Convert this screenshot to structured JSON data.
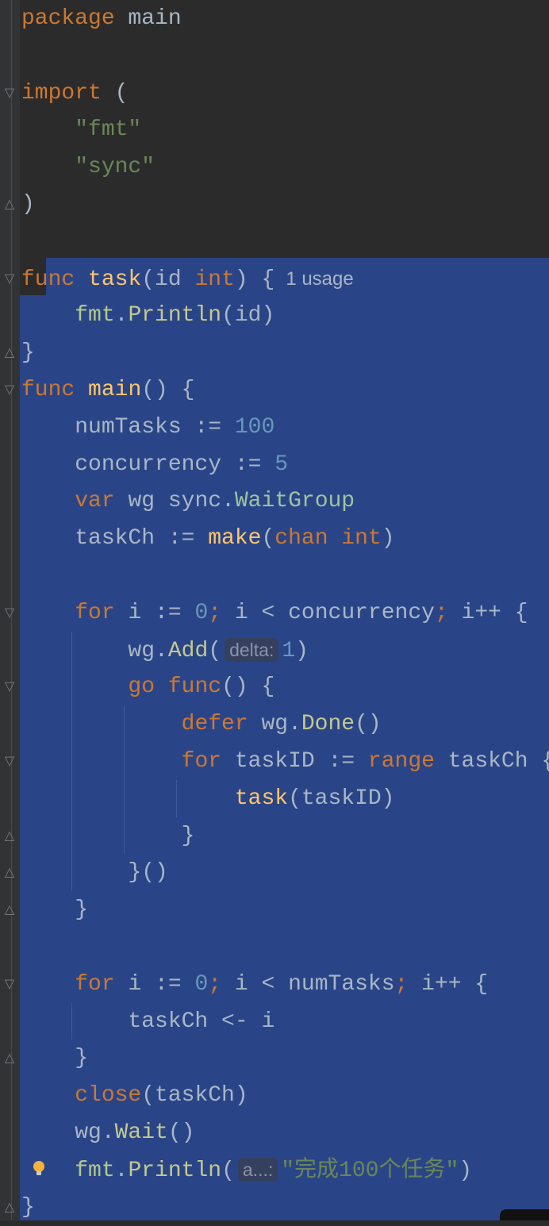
{
  "editor": {
    "colors": {
      "selection": "#2a4587",
      "background": "#2b2b2b",
      "keyword": "#cc7832",
      "function": "#ffc66d",
      "string": "#6a8759",
      "number": "#6897bb"
    },
    "lines": [
      [
        [
          "package",
          "kw"
        ],
        [
          " main",
          "plain"
        ]
      ],
      [],
      [
        [
          "import",
          "kw"
        ],
        [
          " (",
          "plain"
        ]
      ],
      [
        [
          "    ",
          "plain"
        ],
        [
          "\"fmt\"",
          "str"
        ]
      ],
      [
        [
          "    ",
          "plain"
        ],
        [
          "\"sync\"",
          "str"
        ]
      ],
      [
        [
          ")",
          "plain"
        ]
      ],
      [],
      [
        [
          "func",
          "kw"
        ],
        [
          " ",
          "plain"
        ],
        [
          "task",
          "fn"
        ],
        [
          "(id ",
          "plain"
        ],
        [
          "int",
          "kw"
        ],
        [
          ") {",
          "plain"
        ],
        [
          "1 usage",
          "usage"
        ]
      ],
      [
        [
          "    ",
          "plain"
        ],
        [
          "fmt",
          "pkg"
        ],
        [
          ".",
          "plain"
        ],
        [
          "Println",
          "call"
        ],
        [
          "(id)",
          "plain"
        ]
      ],
      [
        [
          "}",
          "plain"
        ]
      ],
      [
        [
          "func",
          "kw"
        ],
        [
          " ",
          "plain"
        ],
        [
          "main",
          "fn"
        ],
        [
          "() {",
          "plain"
        ]
      ],
      [
        [
          "    numTasks := ",
          "plain"
        ],
        [
          "100",
          "num"
        ]
      ],
      [
        [
          "    concurrency := ",
          "plain"
        ],
        [
          "5",
          "num"
        ]
      ],
      [
        [
          "    ",
          "plain"
        ],
        [
          "var",
          "kw"
        ],
        [
          " wg sync.",
          "plain"
        ],
        [
          "WaitGroup",
          "type"
        ]
      ],
      [
        [
          "    taskCh := ",
          "plain"
        ],
        [
          "make",
          "fn"
        ],
        [
          "(",
          "plain"
        ],
        [
          "chan",
          "kw"
        ],
        [
          " ",
          "plain"
        ],
        [
          "int",
          "kw"
        ],
        [
          ")",
          "plain"
        ]
      ],
      [],
      [
        [
          "    ",
          "plain"
        ],
        [
          "for",
          "kw"
        ],
        [
          " i := ",
          "plain"
        ],
        [
          "0",
          "num"
        ],
        [
          "; ",
          "kw"
        ],
        [
          "i < concurrency",
          "plain"
        ],
        [
          "; ",
          "kw"
        ],
        [
          "i++ {",
          "plain"
        ]
      ],
      [
        [
          "        wg.",
          "plain"
        ],
        [
          "Add",
          "call"
        ],
        [
          "(",
          "plain"
        ],
        [
          "delta:",
          "hint"
        ],
        [
          "1",
          "num"
        ],
        [
          ")",
          "plain"
        ]
      ],
      [
        [
          "        ",
          "plain"
        ],
        [
          "go",
          "kw"
        ],
        [
          " ",
          "plain"
        ],
        [
          "func",
          "kw"
        ],
        [
          "() {",
          "plain"
        ]
      ],
      [
        [
          "            ",
          "plain"
        ],
        [
          "defer",
          "kw"
        ],
        [
          " wg.",
          "plain"
        ],
        [
          "Done",
          "call"
        ],
        [
          "()",
          "plain"
        ]
      ],
      [
        [
          "            ",
          "plain"
        ],
        [
          "for",
          "kw"
        ],
        [
          " taskID := ",
          "plain"
        ],
        [
          "range",
          "kw"
        ],
        [
          " taskCh {",
          "plain"
        ]
      ],
      [
        [
          "                ",
          "plain"
        ],
        [
          "task",
          "fn"
        ],
        [
          "(taskID)",
          "plain"
        ]
      ],
      [
        [
          "            }",
          "plain"
        ]
      ],
      [
        [
          "        }()",
          "plain"
        ]
      ],
      [
        [
          "    }",
          "plain"
        ]
      ],
      [],
      [
        [
          "    ",
          "plain"
        ],
        [
          "for",
          "kw"
        ],
        [
          " i := ",
          "plain"
        ],
        [
          "0",
          "num"
        ],
        [
          "; ",
          "kw"
        ],
        [
          "i < numTasks",
          "plain"
        ],
        [
          "; ",
          "kw"
        ],
        [
          "i++ {",
          "plain"
        ]
      ],
      [
        [
          "        taskCh <- i",
          "plain"
        ]
      ],
      [
        [
          "    }",
          "plain"
        ]
      ],
      [
        [
          "    ",
          "plain"
        ],
        [
          "close",
          "kw"
        ],
        [
          "(taskCh)",
          "plain"
        ]
      ],
      [
        [
          "    wg.",
          "plain"
        ],
        [
          "Wait",
          "call"
        ],
        [
          "()",
          "plain"
        ]
      ],
      [
        [
          "    ",
          "plain"
        ],
        [
          "fmt",
          "pkg"
        ],
        [
          ".",
          "plain"
        ],
        [
          "Println",
          "call"
        ],
        [
          "(",
          "plain"
        ],
        [
          "a...:",
          "hint"
        ],
        [
          "\"完成100个任务\"",
          "str"
        ],
        [
          ")",
          "plain"
        ]
      ],
      [
        [
          "}",
          "plain"
        ]
      ]
    ],
    "folds": [
      {
        "line": 3,
        "icon": "fold-open-icon"
      },
      {
        "line": 6,
        "icon": "fold-close-icon"
      },
      {
        "line": 8,
        "icon": "fold-open-icon"
      },
      {
        "line": 10,
        "icon": "fold-close-icon"
      },
      {
        "line": 11,
        "icon": "fold-open-icon"
      },
      {
        "line": 17,
        "icon": "fold-open-icon"
      },
      {
        "line": 19,
        "icon": "fold-open-icon"
      },
      {
        "line": 21,
        "icon": "fold-open-icon"
      },
      {
        "line": 23,
        "icon": "fold-close-icon"
      },
      {
        "line": 24,
        "icon": "fold-close-icon"
      },
      {
        "line": 25,
        "icon": "fold-close-icon"
      },
      {
        "line": 27,
        "icon": "fold-open-icon"
      },
      {
        "line": 29,
        "icon": "fold-close-icon"
      },
      {
        "line": 33,
        "icon": "fold-close-icon"
      }
    ]
  }
}
